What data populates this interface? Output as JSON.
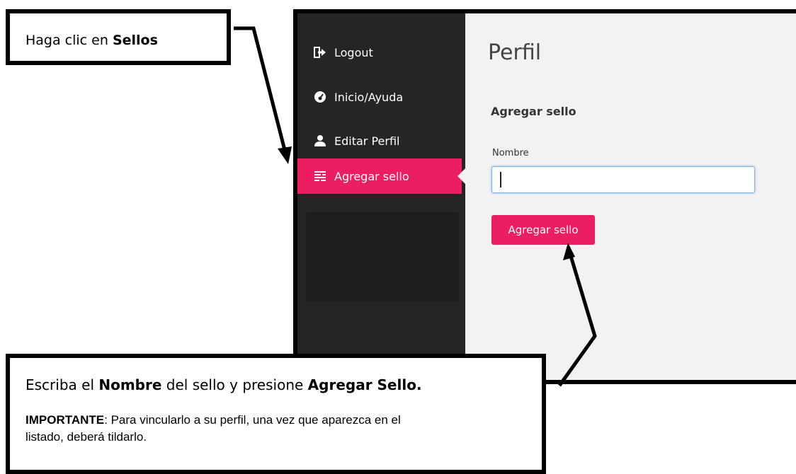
{
  "app": {
    "sidebar": {
      "items": [
        {
          "label": "Logout",
          "icon": "logout-icon"
        },
        {
          "label": "Inicio/Ayuda",
          "icon": "dashboard-icon"
        },
        {
          "label": "Editar Perfil",
          "icon": "user-icon"
        },
        {
          "label": "Agregar sello",
          "icon": "list-icon",
          "active": true
        }
      ]
    },
    "main": {
      "title": "Perfil",
      "section_title": "Agregar sello",
      "name_label": "Nombre",
      "name_value": "",
      "submit_label": "Agregar sello"
    }
  },
  "callouts": {
    "top": {
      "prefix": "Haga clic en ",
      "bold": "Sellos"
    },
    "bottom": {
      "part1": "Escriba el ",
      "bold1": "Nombre",
      "part2": " del sello y presione ",
      "bold2": "Agregar Sello.",
      "note_bold": "IMPORTANTE",
      "note_text": ": Para vincularlo a su perfil, una vez que aparezca en el listado, deberá tildarlo."
    }
  },
  "colors": {
    "accent": "#ec1e62",
    "sidebar_bg": "#252525",
    "main_bg": "#f2f2f2"
  }
}
